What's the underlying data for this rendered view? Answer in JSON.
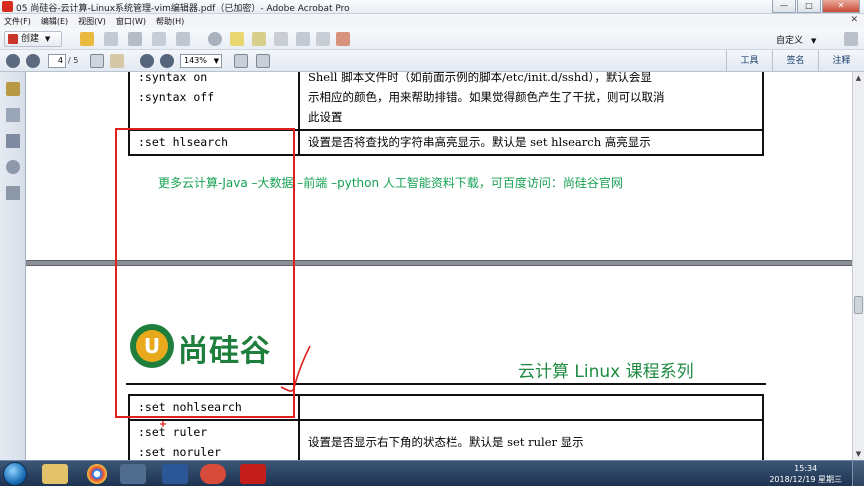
{
  "window": {
    "title": "05 尚硅谷-云计算-Linux系统管理-vim编辑器.pdf（已加密）- Adobe Acrobat Pro",
    "minimize": "—",
    "maximize": "□",
    "close": "✕"
  },
  "menu": {
    "items": [
      "文件(F)",
      "编辑(E)",
      "视图(V)",
      "窗口(W)",
      "帮助(H)"
    ],
    "close_doc": "✕"
  },
  "toolbar": {
    "create_label": "创建",
    "custom_label": "自定义"
  },
  "nav": {
    "current_page": "4",
    "total_pages": "/ 5",
    "zoom": "143%"
  },
  "right_tabs": [
    "工具",
    "签名",
    "注释"
  ],
  "document": {
    "table1": [
      {
        "cmd": [
          ":syntax on",
          ":syntax off"
        ],
        "desc": [
          "Shell 脚本文件时（如前面示例的脚本/etc/init.d/sshd），默认会显",
          "示相应的颜色，用来帮助排错。如果觉得颜色产生了干扰，则可以取消",
          "此设置"
        ]
      },
      {
        "cmd": [
          ":set hlsearch"
        ],
        "desc": [
          "设置是否将查找的字符串高亮显示。默认是 set hlsearch 高亮显示"
        ]
      }
    ],
    "promo": "更多云计算-Java –大数据 –前端 –python 人工智能资料下载，可百度访问：尚硅谷官网",
    "logo_text": "尚硅谷",
    "logo_letter": "U",
    "series_title": "云计算 Linux 课程系列",
    "table2": [
      {
        "cmd": [
          ":set nohlsearch"
        ],
        "desc": [
          ""
        ]
      },
      {
        "cmd": [
          ":set ruler",
          ":set noruler"
        ],
        "desc": [
          "设置是否显示右下角的状态栏。默认是 set ruler 显示"
        ]
      }
    ]
  },
  "scrollbar": {
    "up": "▲",
    "down": "▼"
  },
  "taskbar": {
    "time": "15:34",
    "date": "2018/12/19 星期三"
  },
  "colors": {
    "promo_green": "#17a253",
    "logo_green": "#1e7f3c",
    "annotation_red": "#e0201c"
  }
}
